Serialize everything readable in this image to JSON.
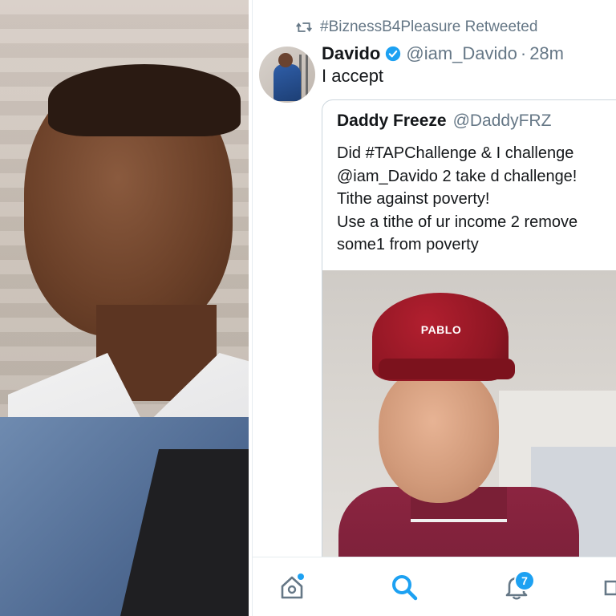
{
  "colors": {
    "accent": "#1da1f2",
    "text_primary": "#14171a",
    "text_secondary": "#657786"
  },
  "retweet": {
    "icon": "retweet-icon",
    "label": "#BiznessB4Pleasure Retweeted"
  },
  "tweet": {
    "avatar": "avatar",
    "display_name": "Davido",
    "verified_icon": "verified-badge-icon",
    "handle": "@iam_Davido",
    "separator": "·",
    "time": "28m",
    "text": "I accept"
  },
  "quoted_tweet": {
    "display_name": "Daddy Freeze",
    "handle": "@DaddyFRZ",
    "lines": [
      "Did #TAPChallenge & I challenge",
      "@iam_Davido 2 take d challenge!",
      "Tithe against poverty!",
      "Use a tithe of ur income 2 remove",
      "some1 from poverty"
    ],
    "media_cap_text": "PABLO"
  },
  "bottom_nav": {
    "items": [
      {
        "icon": "home-icon"
      },
      {
        "icon": "search-icon"
      },
      {
        "icon": "notifications-icon",
        "badge": "7"
      }
    ]
  }
}
